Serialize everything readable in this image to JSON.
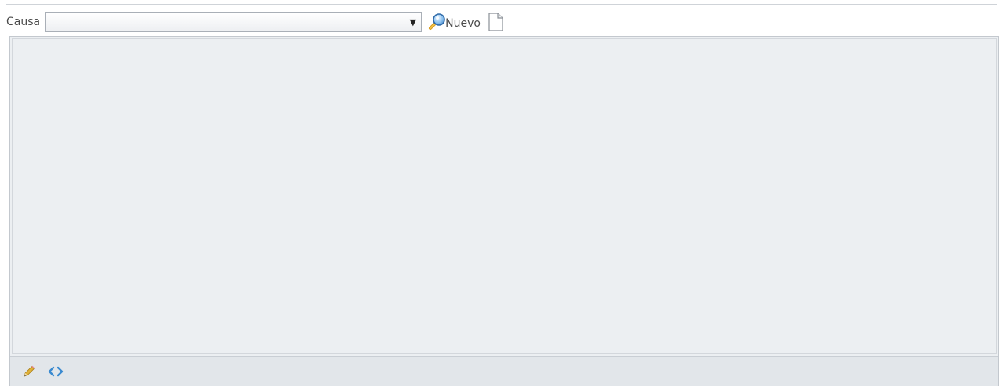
{
  "form": {
    "causa_label": "Causa",
    "causa_selected": "",
    "select_arrow": "▼",
    "nuevo_label": "Nuevo"
  },
  "editor": {
    "content": ""
  },
  "icons": {
    "search": "magnifier-icon",
    "new_document": "document-icon",
    "edit": "pencil-icon",
    "source": "code-icon"
  },
  "colors": {
    "editor_background": "#eceff2",
    "footer_background": "#e2e6ea",
    "code_icon": "#3a8ad0",
    "pencil_icon": "#d4a017"
  }
}
